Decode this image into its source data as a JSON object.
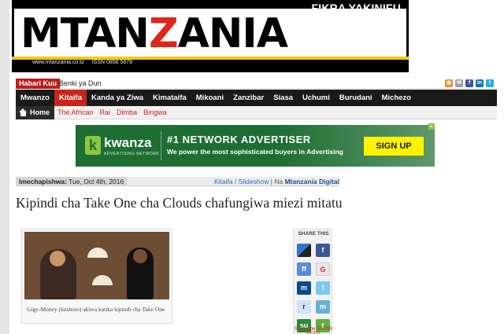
{
  "masthead": {
    "slogan": "FIKRA YAKINIFU",
    "logo_prefix": "MTAN",
    "logo_accent": "Z",
    "logo_suffix": "ANIA",
    "website": "www.mtanzania.co.tz",
    "issn": "ISSN 0856 5679"
  },
  "ticker": {
    "label": "Habari Kuu",
    "text": "Benki ya Dun"
  },
  "share_icons": [
    "rss-icon",
    "mail-icon",
    "facebook-icon",
    "linkedin-icon",
    "twitter-icon"
  ],
  "nav": {
    "items": [
      "Mwanzo",
      "Kitaifa",
      "Kanda ya Ziwa",
      "Kimataifa",
      "Mikoani",
      "Zanzibar",
      "Siasa",
      "Uchumi",
      "Burudani",
      "Michezo"
    ],
    "active": "Kitaifa"
  },
  "subnav": {
    "home_label": "Home",
    "items": [
      "The African",
      "Rai",
      "Dimba",
      "Bingwa"
    ]
  },
  "ad": {
    "logo_letter": "k",
    "brand": "kwanza",
    "brand_sub": "ADVERTISING NETWORK",
    "headline": "#1 NETWORK ADVERTISER",
    "subline": "We power the most sophisticated buyers in Advertising",
    "cta": "SIGN UP"
  },
  "article": {
    "published_label": "Imechapishwa:",
    "published_date": "Tue, Oct 4th, 2016",
    "category_path": "Kitaifa / Slideshow",
    "separator": " | Na ",
    "author": "Mtanzania Digital",
    "title": "Kipindi cha Take One cha Clouds chafungiwa miezi mitatu",
    "caption": "Gigy-Money (kushoto) akiwa katika kipindi cha Take One"
  },
  "share_panel": {
    "title": "SHARE THIS",
    "buttons": [
      {
        "name": "delicious-icon",
        "glyph": ""
      },
      {
        "name": "facebook-icon",
        "glyph": "f"
      },
      {
        "name": "friendfeed-icon",
        "glyph": "ff"
      },
      {
        "name": "google-icon",
        "glyph": "G"
      },
      {
        "name": "myspace-icon",
        "glyph": "m"
      },
      {
        "name": "twitter-icon",
        "glyph": "t"
      },
      {
        "name": "reddit-icon",
        "glyph": "r"
      },
      {
        "name": "messenger-icon",
        "glyph": "m"
      },
      {
        "name": "stumbleupon-icon",
        "glyph": "su"
      },
      {
        "name": "technorati-icon",
        "glyph": "t"
      }
    ],
    "subscribe_label": "Subscribe To RSS FEED"
  },
  "colors": {
    "brand_red": "#c8231c",
    "masthead_yellow": "#f7c90a",
    "ad_green": "#1e6e34",
    "cta_yellow": "#fff200"
  }
}
